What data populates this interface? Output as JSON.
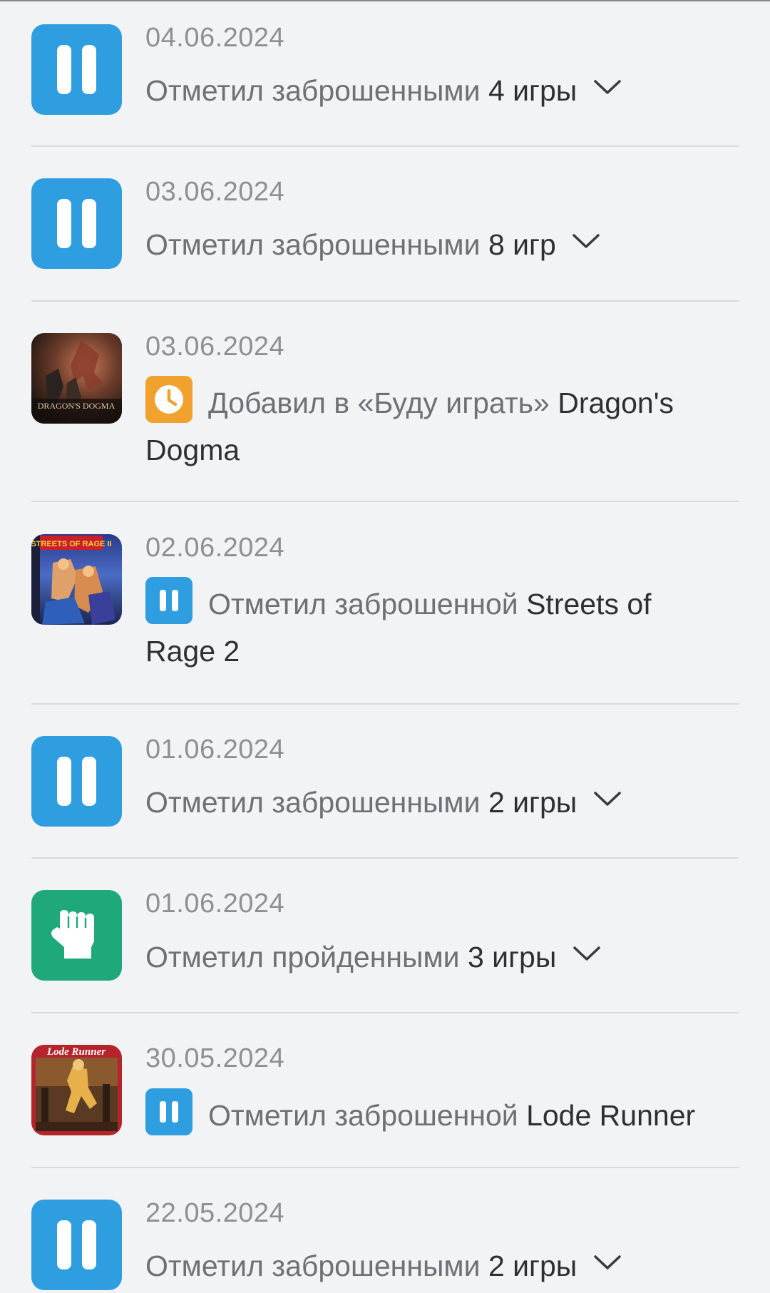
{
  "feed": [
    {
      "date": "04.06.2024",
      "action": "Отметил заброшенными",
      "object": "4 игры",
      "icon": "pause-icon",
      "expandable": true
    },
    {
      "date": "03.06.2024",
      "action": "Отметил заброшенными",
      "object": "8 игр",
      "icon": "pause-icon",
      "expandable": true
    },
    {
      "date": "03.06.2024",
      "action": "Добавил в «Буду играть»",
      "object": "Dragon's",
      "object2": "Dogma",
      "icon": "clock-icon",
      "cover_text": "DRAGON'S DOGMA"
    },
    {
      "date": "02.06.2024",
      "action": "Отметил заброшенной",
      "object": "Streets of",
      "object2": "Rage 2",
      "icon": "pause-icon",
      "cover_text": "STREETS OF RAGE II"
    },
    {
      "date": "01.06.2024",
      "action": "Отметил заброшенными",
      "object": "2 игры",
      "icon": "pause-icon",
      "expandable": true
    },
    {
      "date": "01.06.2024",
      "action": "Отметил пройденными",
      "object": "3 игры",
      "icon": "fist-icon",
      "expandable": true
    },
    {
      "date": "30.05.2024",
      "action": "Отметил заброшенной",
      "object": "Lode Runner",
      "icon": "pause-icon",
      "cover_text": "Lode Runner"
    },
    {
      "date": "22.05.2024",
      "action": "Отметил заброшенными",
      "object": "2 игры",
      "icon": "pause-icon",
      "expandable": true
    }
  ],
  "colors": {
    "pause": "#2f9ee0",
    "pass": "#1fa97a",
    "plan": "#f1a12e",
    "background": "#f2f3f5"
  }
}
